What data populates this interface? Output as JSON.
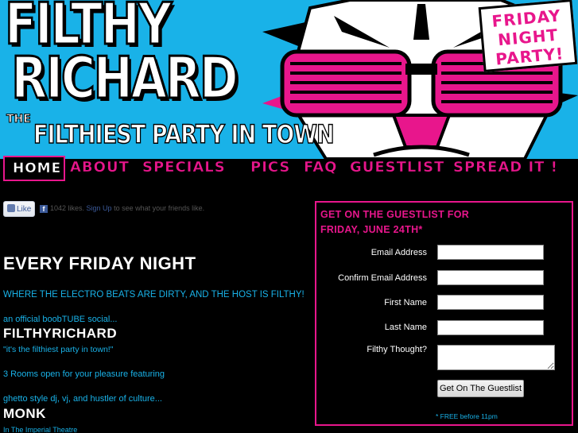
{
  "banner": {
    "title_line1": "FILTHY",
    "title_line2": "RICHARD",
    "tagline_prefix": "THE",
    "tagline": "FILTHIEST PARTY IN TOWN",
    "badge_lines": [
      "FRIDAY",
      "NIGHT",
      "PARTY!"
    ]
  },
  "nav": {
    "items": [
      "HOME",
      "ABOUT",
      "SPECIALS",
      "PICS",
      "FAQ",
      "GUESTLIST",
      "SPREAD IT !"
    ]
  },
  "facebook": {
    "like_label": "Like",
    "count_text": "1042 likes.",
    "signup_link": "Sign Up",
    "signup_suffix": "to see what your friends like."
  },
  "content": {
    "headline": "EVERY FRIDAY NIGHT",
    "electro": "WHERE THE ELECTRO BEATS ARE DIRTY, AND THE HOST IS FILTHY!",
    "official": "an official boobTUBE social...",
    "host_name": "FILTHYRICHARD",
    "quote": "\"it's the filthiest party in town!\"",
    "rooms": "3 Rooms open for your pleasure featuring",
    "ghetto": "ghetto style dj, vj, and hustler of culture...",
    "dj_name": "MONK",
    "venue": "In The Imperial Theatre"
  },
  "guestlist": {
    "title_line1": "GET ON THE GUESTLIST FOR",
    "title_line2": "FRIDAY, JUNE 24TH*",
    "fields": {
      "email": "Email Address",
      "confirm_email": "Confirm Email Address",
      "first_name": "First Name",
      "last_name": "Last Name",
      "thought": "Filthy Thought?"
    },
    "submit_label": "Get On The Guestlist",
    "note": "* FREE before 11pm"
  },
  "colors": {
    "accent_pink": "#e8168c",
    "sky_blue": "#19b2e8"
  }
}
